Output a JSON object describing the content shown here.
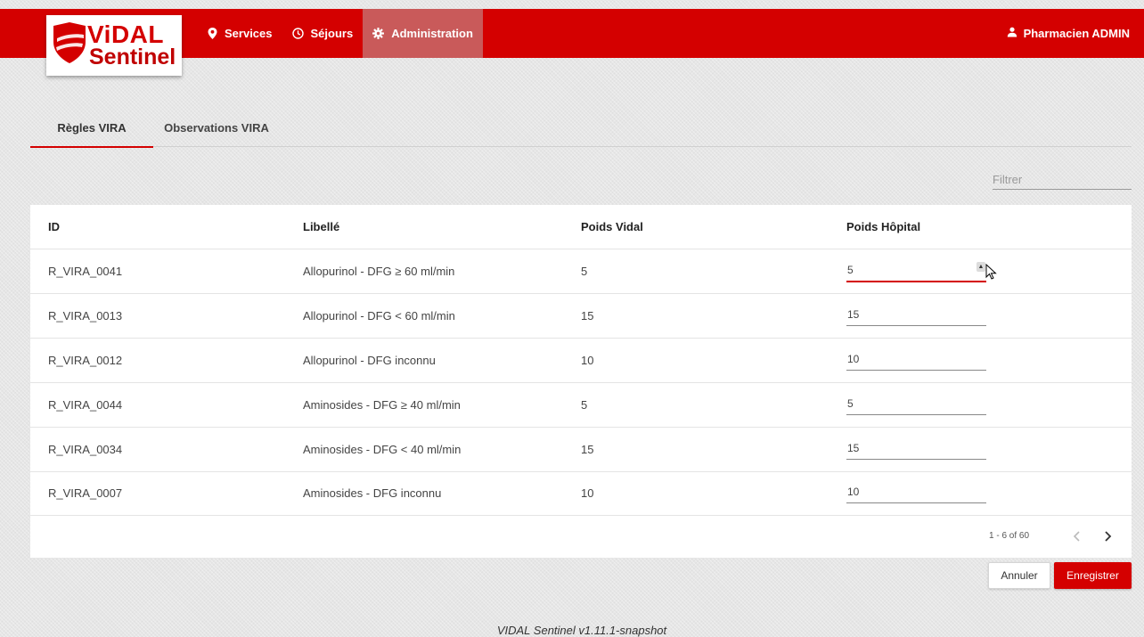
{
  "app": {
    "logo_line1": "ViDAL",
    "logo_line2": "Sentinel",
    "brand_color": "#d40000"
  },
  "nav": {
    "items": [
      {
        "label": "Services",
        "icon": "map-marker-icon"
      },
      {
        "label": "Séjours",
        "icon": "clock-icon"
      },
      {
        "label": "Administration",
        "icon": "gear-icon",
        "active": true
      }
    ],
    "user_label": "Pharmacien ADMIN",
    "user_icon": "user-icon"
  },
  "tabs": [
    {
      "label": "Règles VIRA",
      "active": true
    },
    {
      "label": "Observations VIRA",
      "active": false
    }
  ],
  "filter": {
    "placeholder": "Filtrer",
    "value": ""
  },
  "table": {
    "headers": [
      "ID",
      "Libellé",
      "Poids Vidal",
      "Poids Hôpital"
    ],
    "rows": [
      {
        "id": "R_VIRA_0041",
        "libelle": "Allopurinol - DFG ≥ 60 ml/min",
        "poids_vidal": "5",
        "poids_hopital": "5"
      },
      {
        "id": "R_VIRA_0013",
        "libelle": "Allopurinol - DFG < 60 ml/min",
        "poids_vidal": "15",
        "poids_hopital": "15"
      },
      {
        "id": "R_VIRA_0012",
        "libelle": "Allopurinol - DFG inconnu",
        "poids_vidal": "10",
        "poids_hopital": "10"
      },
      {
        "id": "R_VIRA_0044",
        "libelle": "Aminosides - DFG ≥ 40 ml/min",
        "poids_vidal": "5",
        "poids_hopital": "5"
      },
      {
        "id": "R_VIRA_0034",
        "libelle": "Aminosides - DFG < 40 ml/min",
        "poids_vidal": "15",
        "poids_hopital": "15"
      },
      {
        "id": "R_VIRA_0007",
        "libelle": "Aminosides - DFG inconnu",
        "poids_vidal": "10",
        "poids_hopital": "10"
      }
    ]
  },
  "pagination": {
    "range_label": "1 - 6 of 60"
  },
  "buttons": {
    "cancel": "Annuler",
    "save": "Enregistrer"
  },
  "footer": {
    "version": "VIDAL Sentinel v1.11.1-snapshot"
  }
}
